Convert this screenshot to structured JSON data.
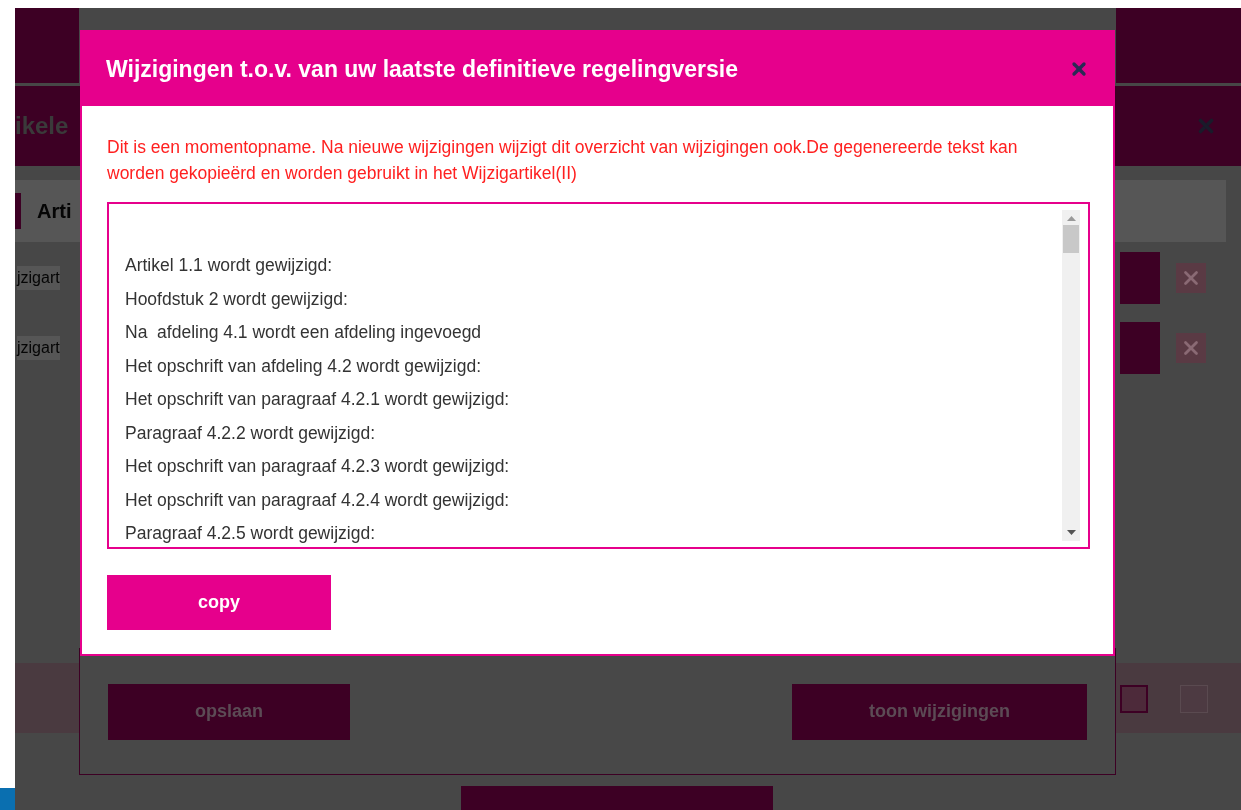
{
  "background": {
    "dialog_title": "ikele",
    "tab": "Arti",
    "rows": [
      {
        "label": "jzigart"
      },
      {
        "label": "jzigart"
      }
    ],
    "buttons": [
      "opslaan",
      "toon wijzigingen"
    ]
  },
  "modal": {
    "title": "Wijzigingen t.o.v. van uw laatste definitieve regelingversie",
    "notice": "Dit is een momentopname. Na nieuwe wijzigingen wijzigt dit overzicht van wijzigingen ook.De gegenereerde tekst kan worden gekopieërd en worden gebruikt in het Wijzigartikel(II)",
    "changes": [
      "Artikel 1.1 wordt gewijzigd:",
      "Hoofdstuk 2 wordt gewijzigd:",
      "Na  afdeling 4.1 wordt een afdeling ingevoegd",
      "Het opschrift van afdeling 4.2 wordt gewijzigd:",
      "Het opschrift van paragraaf 4.2.1 wordt gewijzigd:",
      "Paragraaf 4.2.2 wordt gewijzigd:",
      "Het opschrift van paragraaf 4.2.3 wordt gewijzigd:",
      "Het opschrift van paragraaf 4.2.4 wordt gewijzigd:",
      "Paragraaf 4.2.5 wordt gewijzigd:"
    ],
    "copy_button": "copy"
  }
}
